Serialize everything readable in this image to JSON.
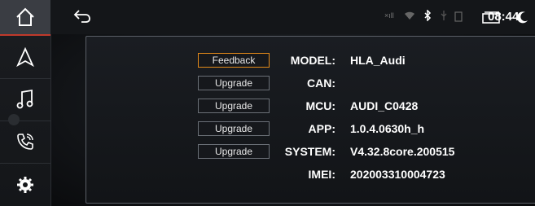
{
  "status_bar": {
    "time": "08:44",
    "signal_text": "×ıll"
  },
  "buttons": {
    "feedback": "Feedback",
    "upgrade_can": "Upgrade",
    "upgrade_mcu": "Upgrade",
    "upgrade_app": "Upgrade",
    "upgrade_system": "Upgrade"
  },
  "info": {
    "model_label": "MODEL:",
    "model_value": "HLA_Audi",
    "can_label": "CAN:",
    "can_value": "",
    "mcu_label": "MCU:",
    "mcu_value": "AUDI_C0428",
    "app_label": "APP:",
    "app_value": "1.0.4.0630h_h",
    "system_label": "SYSTEM:",
    "system_value": "V4.32.8core.200515",
    "imei_label": "IMEI:",
    "imei_value": "202003310004723"
  },
  "colors": {
    "accent_orange": "#e38a1a",
    "home_underline": "#c0392b"
  },
  "icons": [
    "home-icon",
    "navigation-icon",
    "music-icon",
    "phone-icon",
    "settings-icon",
    "back-icon",
    "wifi-icon",
    "bluetooth-icon",
    "usb-icon",
    "battery-icon",
    "recent-apps-icon",
    "night-mode-icon"
  ]
}
